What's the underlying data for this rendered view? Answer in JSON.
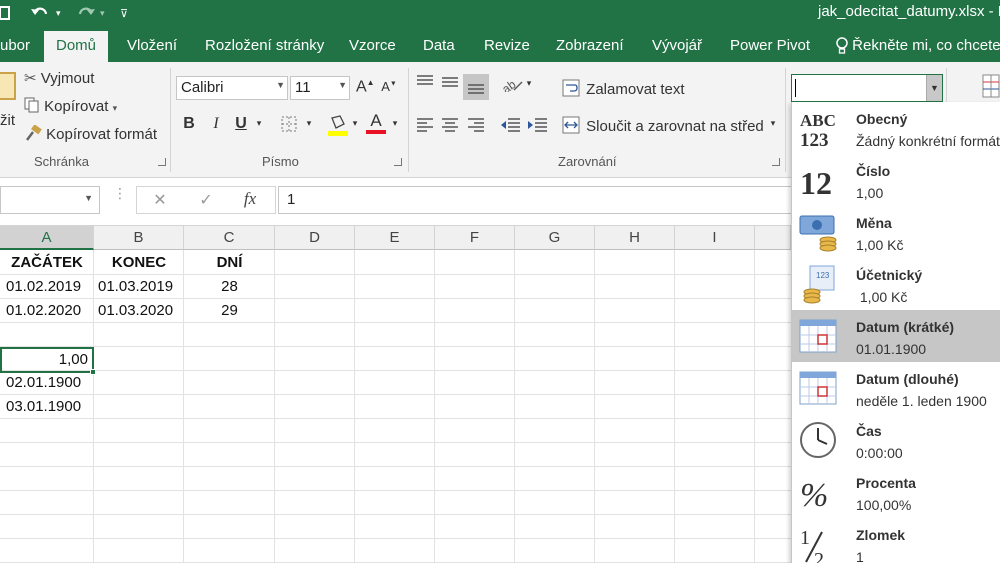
{
  "titlebar": {
    "title": "jak_odecitat_datumy.xlsx - E",
    "save_icon": "save-icon",
    "undo_icon": "undo-icon",
    "redo_icon": "redo-icon"
  },
  "tabs": [
    {
      "label": "ubor"
    },
    {
      "label": "Domů",
      "active": true
    },
    {
      "label": "Vložení"
    },
    {
      "label": "Rozložení stránky"
    },
    {
      "label": "Vzorce"
    },
    {
      "label": "Data"
    },
    {
      "label": "Revize"
    },
    {
      "label": "Zobrazení"
    },
    {
      "label": "Vývojář"
    },
    {
      "label": "Power Pivot"
    }
  ],
  "tellme": {
    "text": "Řekněte mi, co chcete"
  },
  "clipboard": {
    "paste_label": "žit",
    "cut_label": "Vyjmout",
    "copy_label": "Kopírovat",
    "format_painter_label": "Kopírovat formát",
    "group_label": "Schránka"
  },
  "font": {
    "family": "Calibri",
    "size": "11",
    "bold": "B",
    "italic": "I",
    "underline": "U",
    "group_label": "Písmo",
    "highlight_color": "#ffff00",
    "font_color": "#e81123"
  },
  "alignment": {
    "wrap_label": "Zalamovat text",
    "merge_label": "Sloučit a zarovnat na střed",
    "group_label": "Zarovnání"
  },
  "formula_bar": {
    "cancel": "✕",
    "enter": "✓",
    "fx": "fx",
    "value": "1"
  },
  "grid": {
    "columns": [
      "A",
      "B",
      "C",
      "D",
      "E",
      "F",
      "G",
      "H",
      "I"
    ],
    "selected_column": "A",
    "cells": {
      "A1": "ZAČÁTEK",
      "B1": "KONEC",
      "C1": "DNÍ",
      "A2": "01.02.2019",
      "B2": "01.03.2019",
      "C2": "28",
      "A3": "01.02.2020",
      "B3": "01.03.2020",
      "C3": "29",
      "A5": "1,00",
      "A6": "02.01.1900",
      "A7": "03.01.1900"
    }
  },
  "number_format": {
    "current_value": "",
    "items": [
      {
        "name": "Obecný",
        "example": "Žádný konkrétní formát",
        "icon": "general-format-icon"
      },
      {
        "name": "Číslo",
        "example": "1,00",
        "icon": "number-format-icon"
      },
      {
        "name": "Měna",
        "example": "1,00 Kč",
        "icon": "currency-icon"
      },
      {
        "name": "Účetnický",
        "example": " 1,00 Kč",
        "icon": "accounting-icon"
      },
      {
        "name": "Datum (krátké)",
        "example": "01.01.1900",
        "icon": "short-date-icon",
        "highlighted": true
      },
      {
        "name": "Datum (dlouhé)",
        "example": "neděle 1. leden 1900",
        "icon": "long-date-icon"
      },
      {
        "name": "Čas",
        "example": "0:00:00",
        "icon": "clock-icon"
      },
      {
        "name": "Procenta",
        "example": "100,00%",
        "icon": "percent-icon"
      },
      {
        "name": "Zlomek",
        "example": "1",
        "icon": "fraction-icon"
      }
    ]
  }
}
